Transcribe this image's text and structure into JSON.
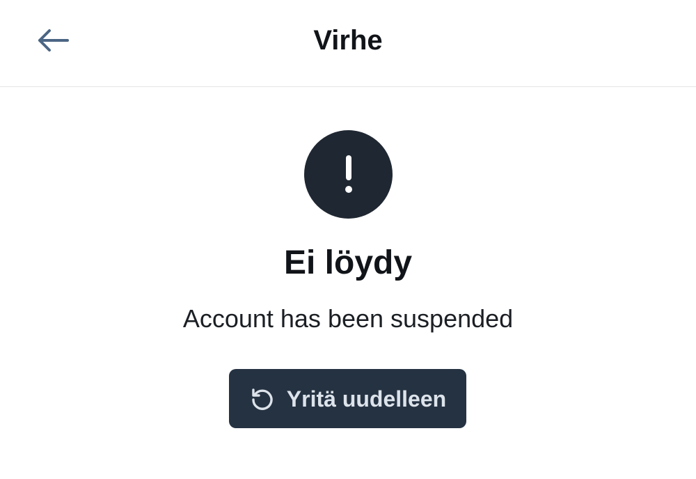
{
  "header": {
    "title": "Virhe",
    "back_icon": "arrow-left-icon"
  },
  "error": {
    "icon": "exclamation-icon",
    "title": "Ei löydy",
    "message": "Account has been suspended"
  },
  "retry": {
    "label": "Yritä uudelleen",
    "icon": "refresh-icon"
  },
  "colors": {
    "icon_circle": "#1f2732",
    "button_bg": "#253242",
    "back_arrow": "#4b6584",
    "divider": "#e3e5e8"
  }
}
